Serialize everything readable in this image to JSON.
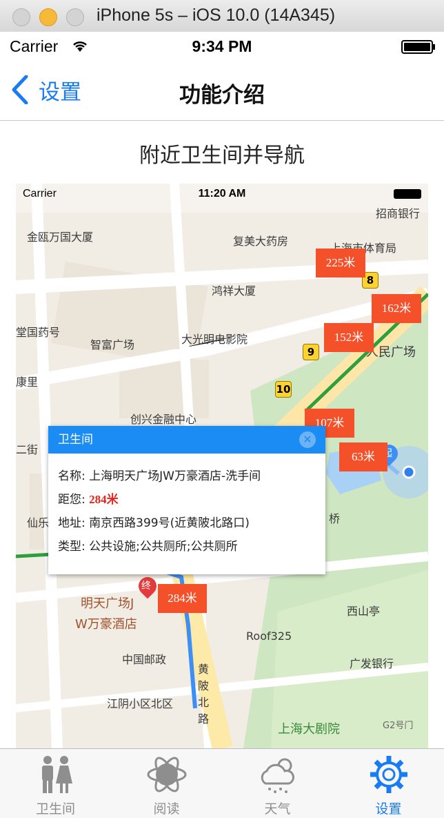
{
  "window": {
    "title": "iPhone 5s – iOS 10.0 (14A345)"
  },
  "status_bar": {
    "carrier": "Carrier",
    "time": "9:34 PM"
  },
  "nav": {
    "back_label": "设置",
    "title": "功能介绍"
  },
  "page": {
    "subtitle": "附近卫生间并导航"
  },
  "screenshot": {
    "status_bar": {
      "carrier": "Carrier",
      "time": "11:20 AM"
    },
    "map_labels": [
      "招商银行",
      "金瓯万国大厦",
      "复美大药房",
      "上海市体育局",
      "鸿祥大厦",
      "堂国药号",
      "智富广场",
      "大光明电影院",
      "人民广场",
      "康里",
      "创兴金融中心",
      "二街",
      "仙乐",
      "明天广场J",
      "W万豪酒店",
      "桥",
      "西山亭",
      "Roof325",
      "中国邮政",
      "广发银行",
      "江阴小区北区",
      "上海大剧院",
      "G2号门",
      "黄陂北路",
      "终",
      "起"
    ],
    "route_numbers": [
      "8",
      "9",
      "10"
    ],
    "distance_markers": [
      "225米",
      "162米",
      "152米",
      "107米",
      "63米",
      "284米"
    ],
    "popup": {
      "title": "卫生间",
      "name_label": "名称:",
      "name_value": "上海明天广场JW万豪酒店-洗手间",
      "distance_label": "距您:",
      "distance_value": "284米",
      "address_label": "地址:",
      "address_value": "南京西路399号(近黄陂北路口)",
      "type_label": "类型:",
      "type_value": "公共设施;公共厕所;公共厕所"
    }
  },
  "tabs": [
    {
      "label": "卫生间",
      "icon": "restroom-icon",
      "active": false
    },
    {
      "label": "阅读",
      "icon": "atom-icon",
      "active": false
    },
    {
      "label": "天气",
      "icon": "weather-icon",
      "active": false
    },
    {
      "label": "设置",
      "icon": "gear-icon",
      "active": true
    }
  ],
  "colors": {
    "accent": "#1a7cf2",
    "tab_inactive": "#8e8e8e",
    "marker": "#f4502a",
    "popup_header": "#1c8cf5"
  }
}
